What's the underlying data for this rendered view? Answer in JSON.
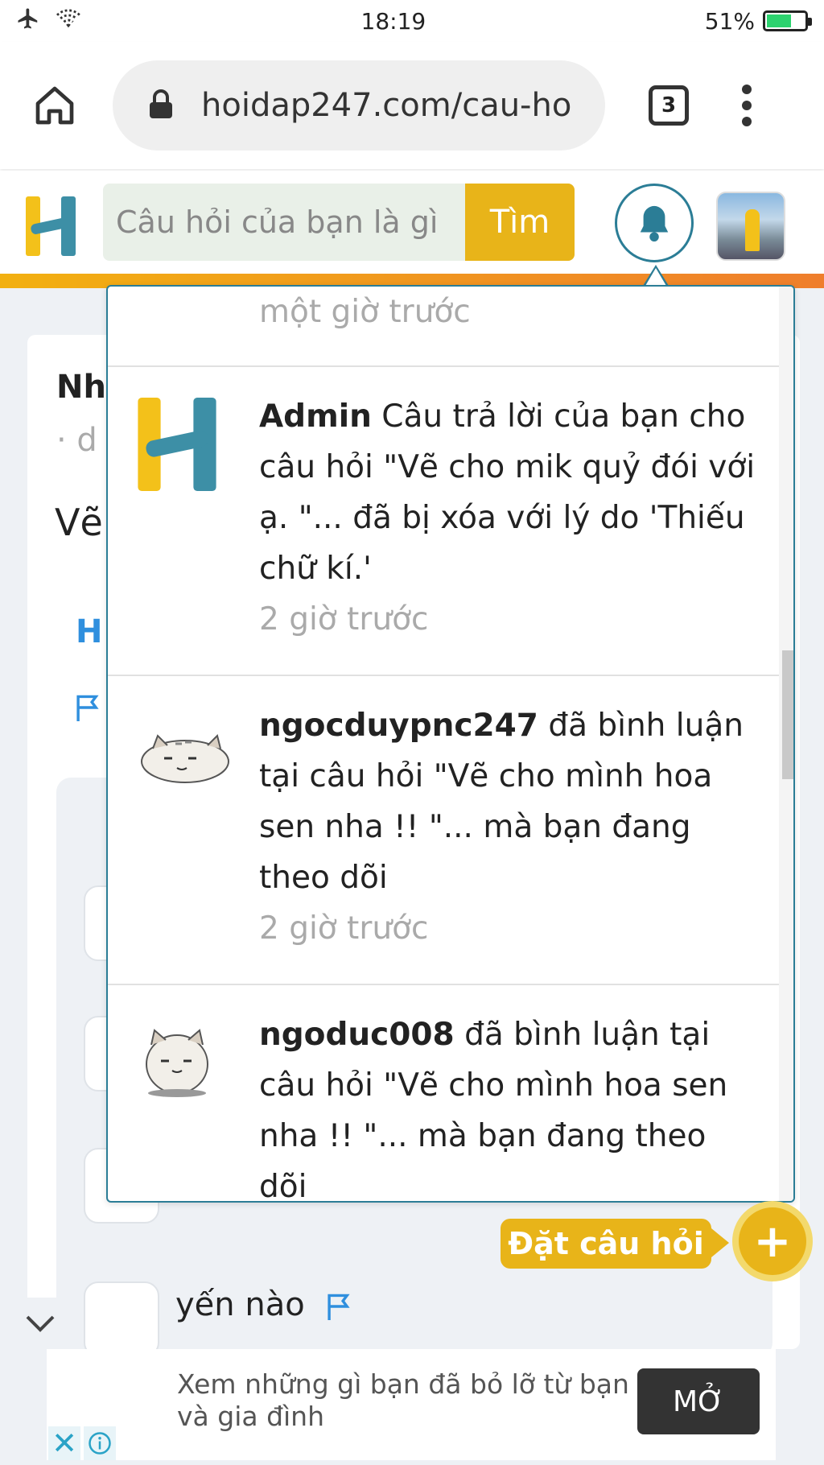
{
  "status_bar": {
    "time": "18:19",
    "battery": "51%",
    "icons": [
      "airplane-icon",
      "wifi-icon",
      "battery-icon"
    ]
  },
  "browser": {
    "url": "hoidap247.com/cau-ho",
    "tab_count": "3"
  },
  "site_header": {
    "search_placeholder": "Câu hỏi của bạn là gì",
    "search_button": "Tìm"
  },
  "page_background": {
    "title_fragment": "Nh",
    "meta_fragment": "· d",
    "question_fragment": "Vẽ",
    "link_fragment": "H",
    "answer_text": "yến nào"
  },
  "notifications": {
    "partial_top_time": "một giờ trước",
    "items": [
      {
        "user": "Admin",
        "text": "Câu trả lời của bạn cho câu hỏi \"Vẽ cho mik quỷ đói với ạ. \"... đã bị xóa với lý do 'Thiếu chữ kí.'",
        "time": "2 giờ trước",
        "avatar": "hoidap-logo-icon"
      },
      {
        "user": "ngocduypnc247",
        "text": "đã bình luận tại câu hỏi \"Vẽ cho mình hoa sen nha !! \"... mà bạn đang theo dõi",
        "time": "2 giờ trước",
        "avatar": "cat-sticker-icon"
      },
      {
        "user": "ngoduc008",
        "text": "đã bình luận tại câu hỏi \"Vẽ cho mình hoa sen nha !! \"... mà bạn đang theo dõi",
        "time": "",
        "avatar": "cat-sticker-icon"
      }
    ]
  },
  "ask_button": {
    "label": "Đặt câu hỏi",
    "icon": "+"
  },
  "ad": {
    "text": "Xem những gì bạn đã bỏ lỡ từ bạn bè và gia đình",
    "button": "MỞ"
  },
  "colors": {
    "brand_yellow": "#e8b419",
    "brand_teal": "#2b7d96",
    "strip_orange": "#ef7e2c"
  }
}
